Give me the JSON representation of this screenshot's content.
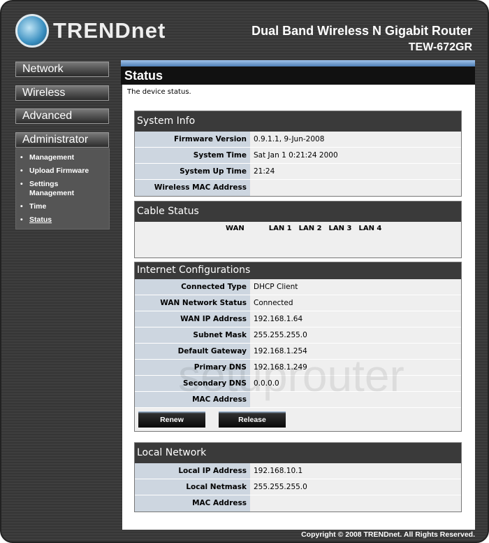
{
  "header": {
    "logo_text": "TRENDnet",
    "product": "Dual Band Wireless N Gigabit Router",
    "model": "TEW-672GR"
  },
  "nav": {
    "items": [
      "Network",
      "Wireless",
      "Advanced",
      "Administrator"
    ],
    "submenu": [
      "Management",
      "Upload Firmware",
      "Settings Management",
      "Time",
      "Status"
    ],
    "active": "Status"
  },
  "page": {
    "title": "Status",
    "description": "The device status."
  },
  "system_info": {
    "title": "System Info",
    "rows": [
      {
        "label": "Firmware Version",
        "value": "0.9.1.1, 9-Jun-2008"
      },
      {
        "label": "System Time",
        "value": "Sat Jan 1 0:21:24 2000"
      },
      {
        "label": "System Up Time",
        "value": "21:24"
      },
      {
        "label": "Wireless MAC Address",
        "value": ""
      }
    ]
  },
  "cable_status": {
    "title": "Cable Status",
    "ports": [
      "WAN",
      "LAN 1",
      "LAN 2",
      "LAN 3",
      "LAN 4"
    ]
  },
  "internet": {
    "title": "Internet Configurations",
    "rows": [
      {
        "label": "Connected Type",
        "value": "DHCP Client"
      },
      {
        "label": "WAN Network Status",
        "value": "Connected"
      },
      {
        "label": "WAN IP Address",
        "value": "192.168.1.64"
      },
      {
        "label": "Subnet Mask",
        "value": "255.255.255.0"
      },
      {
        "label": "Default Gateway",
        "value": "192.168.1.254"
      },
      {
        "label": "Primary DNS",
        "value": "192.168.1.249"
      },
      {
        "label": "Secondary DNS",
        "value": "0.0.0.0"
      },
      {
        "label": "MAC Address",
        "value": ""
      }
    ],
    "renew_label": "Renew",
    "release_label": "Release"
  },
  "local": {
    "title": "Local Network",
    "rows": [
      {
        "label": "Local IP Address",
        "value": "192.168.10.1"
      },
      {
        "label": "Local Netmask",
        "value": "255.255.255.0"
      },
      {
        "label": "MAC Address",
        "value": ""
      }
    ]
  },
  "watermark": "setuprouter",
  "footer": {
    "copyright": "Copyright © 2008 TRENDnet. All Rights Reserved."
  }
}
